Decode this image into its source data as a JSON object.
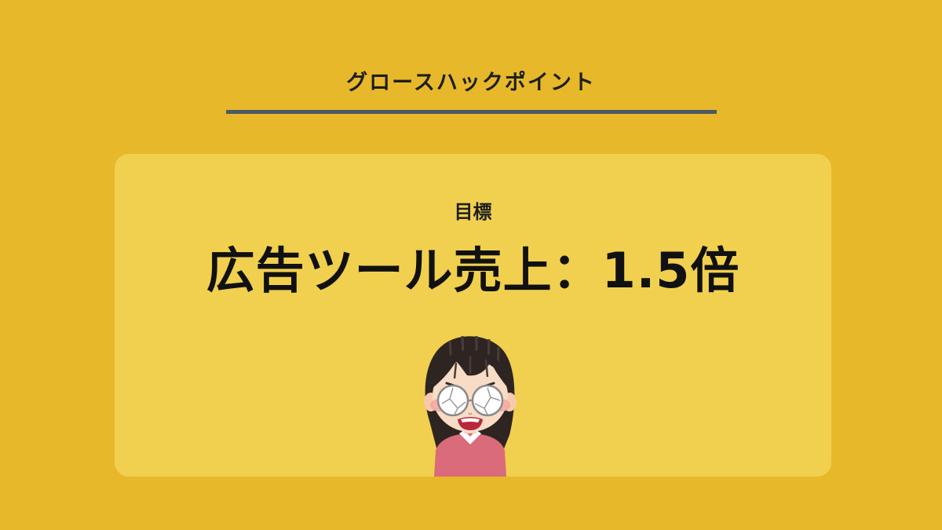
{
  "header": {
    "title": "グロースハックポイント"
  },
  "panel": {
    "goal_label": "目標",
    "goal_value": "広告ツール売上：1.5倍"
  },
  "illustration": {
    "icon": "frustrated-woman-icon"
  },
  "colors": {
    "background": "#e6b82a",
    "panel": "#f1d04f",
    "rule": "#4c5866",
    "text": "#1e1e1e"
  }
}
